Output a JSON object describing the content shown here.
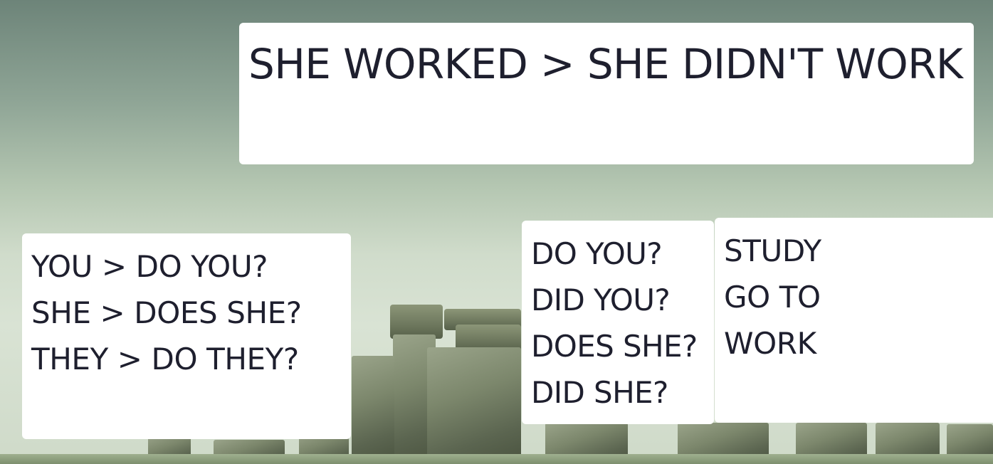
{
  "title_card": {
    "text": "SHE WORKED > SHE DIDN'T WORK"
  },
  "pronoun_card": {
    "lines": [
      "YOU > DO YOU?",
      "SHE > DOES SHE?",
      "THEY > DO THEY?"
    ]
  },
  "question_card": {
    "lines": [
      "DO YOU?",
      "DID YOU?",
      "DOES SHE?",
      "DID SHE?"
    ]
  },
  "verb_card": {
    "lines": [
      "STUDY",
      "GO TO",
      "WORK"
    ]
  },
  "background": {
    "scene": "stonehenge-photo",
    "sky_color": "#8fa596",
    "stone_color": "#7c876c"
  }
}
